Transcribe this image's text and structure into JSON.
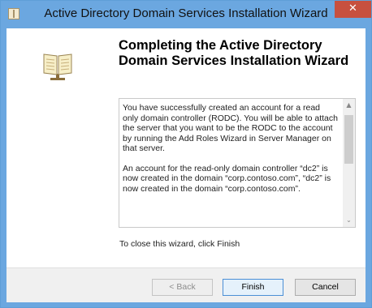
{
  "window": {
    "title": "Active Directory Domain Services Installation Wizard",
    "close_label": "✕"
  },
  "main": {
    "heading": "Completing the Active Directory Domain Services Installation Wizard",
    "summary_paragraphs": [
      "You have successfully created an account for a read only domain controller (RODC). You will be able to attach the server that you want to be the RODC to the account by running the Add Roles Wizard in Server Manager on that server.",
      "An account for the read-only domain controller “dc2” is now created in the domain “corp.contoso.com”, “dc2” is now created in the domain “corp.contoso.com”."
    ],
    "scroll_up_glyph": "▲",
    "scroll_down_glyph": "⌄",
    "finish_hint": "To close this wizard, click Finish"
  },
  "footer": {
    "back_label": "< Back",
    "finish_label": "Finish",
    "cancel_label": "Cancel"
  },
  "colors": {
    "titlebar": "#6ba7e0",
    "close_button": "#c7503f",
    "primary_button_border": "#4b8fd6"
  },
  "icons": {
    "app": "ad-book-icon",
    "sidebar": "book-icon"
  }
}
